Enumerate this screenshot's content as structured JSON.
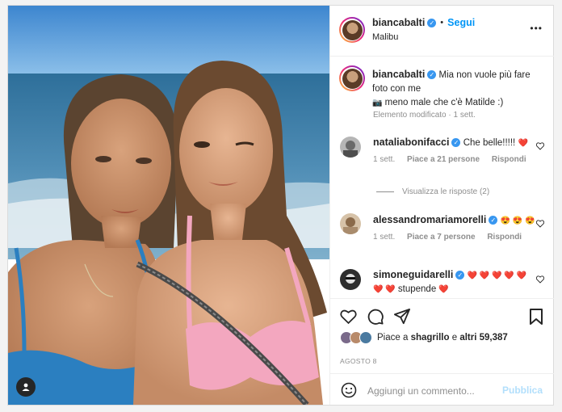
{
  "post": {
    "username": "biancabalti",
    "follow_label": "Segui",
    "location": "Malibu",
    "more_label": "•••",
    "bullet": "•"
  },
  "caption": {
    "username": "biancabalti",
    "line1": "Mia non vuole più fare",
    "line2": "foto con me",
    "line3": "meno male che c'è Matilde :)",
    "meta": "Elemento modificato · 1 sett."
  },
  "comments": [
    {
      "username": "nataliabonifacci",
      "text": "Che belle!!!!!",
      "emoji": "❤️",
      "time": "1 sett.",
      "likes": "Piace a 21 persone",
      "reply": "Rispondi"
    },
    {
      "username": "alessandromariamorelli",
      "text": "",
      "emoji": "😍 😍 😍",
      "time": "1 sett.",
      "likes": "Piace a 7 persone",
      "reply": "Rispondi"
    },
    {
      "username": "simoneguidarelli",
      "emoji": "❤️ ❤️ ❤️ ❤️ ❤️",
      "line2_emoji": "❤️ ❤️",
      "text": "stupende",
      "trail_emoji": "❤️"
    }
  ],
  "view_replies": "Visualizza le risposte (2)",
  "likes": {
    "prefix": "Piace a",
    "user": "shagrillo",
    "middle": "e",
    "others": "altri 59,387"
  },
  "date": "AGOSTO 8",
  "add_comment": {
    "placeholder": "Aggiungi un commento...",
    "publish": "Pubblica"
  },
  "icons": {
    "like": "heart-icon",
    "comment": "comment-icon",
    "share": "share-icon",
    "save": "bookmark-icon",
    "emoji": "smiley-icon",
    "tag": "user-tag-icon"
  },
  "colors": {
    "link": "#0095f6",
    "verified": "#3897f0",
    "heart": "#ed4956"
  }
}
